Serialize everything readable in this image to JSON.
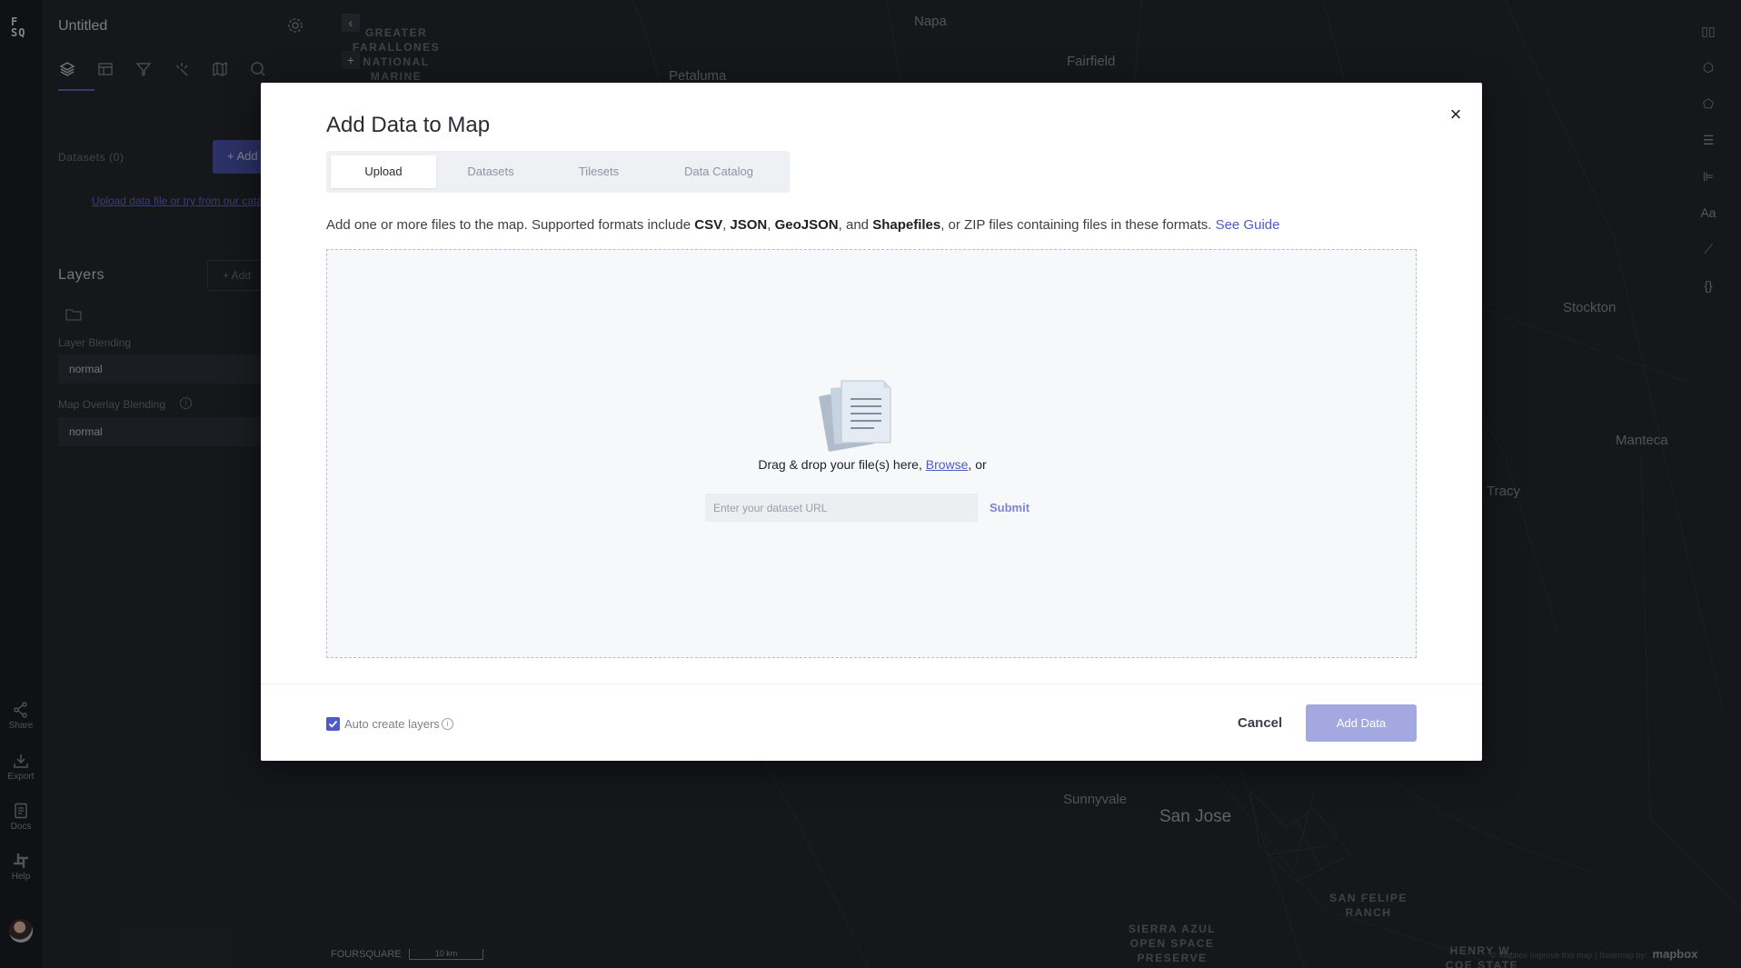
{
  "rail": {
    "logo_line1": "F",
    "logo_line2": "SQ",
    "share": "Share",
    "export": "Export",
    "docs": "Docs",
    "help": "Help"
  },
  "panel": {
    "title": "Untitled",
    "datasets_label": "Datasets (0)",
    "add_button": "+ Add",
    "upload_link": "Upload data file or try from our catalog",
    "layers_heading": "Layers",
    "add_layer": "+ Add",
    "layer_blending_label": "Layer Blending",
    "layer_blending_value": "normal",
    "map_overlay_label": "Map Overlay Blending",
    "map_overlay_value": "normal"
  },
  "map": {
    "cities": [
      "Napa",
      "Fairfield",
      "Petaluma",
      "Stockton",
      "Manteca",
      "Tracy",
      "Sunnyvale",
      "San Jose"
    ],
    "areas": [
      "GREATER FARALLONES NATIONAL MARINE",
      "SAN FELIPE RANCH",
      "SIERRA AZUL OPEN SPACE PRESERVE",
      "HENRY W. COE STATE"
    ],
    "attribution": "FOURSQUARE",
    "scale": "10 km",
    "mapbox_note": "© Mapbox  Improve this map | Basemap by:",
    "mapbox_brand": "mapbox",
    "right_tools": [
      "split-view-icon",
      "3d-box-icon",
      "draw-polygon-icon",
      "legend-list-icon",
      "align-left-icon",
      "text-Aa-icon",
      "ruler-icon",
      "json-braces-icon"
    ],
    "right_tool_glyphs": [
      "▯▯",
      "⬡",
      "⬠",
      "☰",
      "⊫",
      "Aa",
      "⟋",
      "{}"
    ]
  },
  "modal": {
    "title": "Add Data to Map",
    "tabs": [
      "Upload",
      "Datasets",
      "Tilesets",
      "Data Catalog"
    ],
    "desc_intro": "Add one or more files to the map. Supported formats include ",
    "fmt_csv": "CSV",
    "fmt_json": "JSON",
    "fmt_geojson": "GeoJSON",
    "fmt_shp": "Shapefiles",
    "desc_tail": ", or ZIP files containing files in these formats. ",
    "see_guide": "See Guide",
    "drag_text": "Drag & drop your file(s) here, ",
    "browse": "Browse",
    "or": ", or",
    "url_placeholder": "Enter your dataset URL",
    "submit": "Submit",
    "auto_create": "Auto create layers",
    "cancel": "Cancel",
    "add_data": "Add Data"
  },
  "colors": {
    "accent": "#4f5bc6",
    "add_data_disabled": "#a4a8e0",
    "map_bg": "#1e2126",
    "panel_bg": "#202227"
  }
}
